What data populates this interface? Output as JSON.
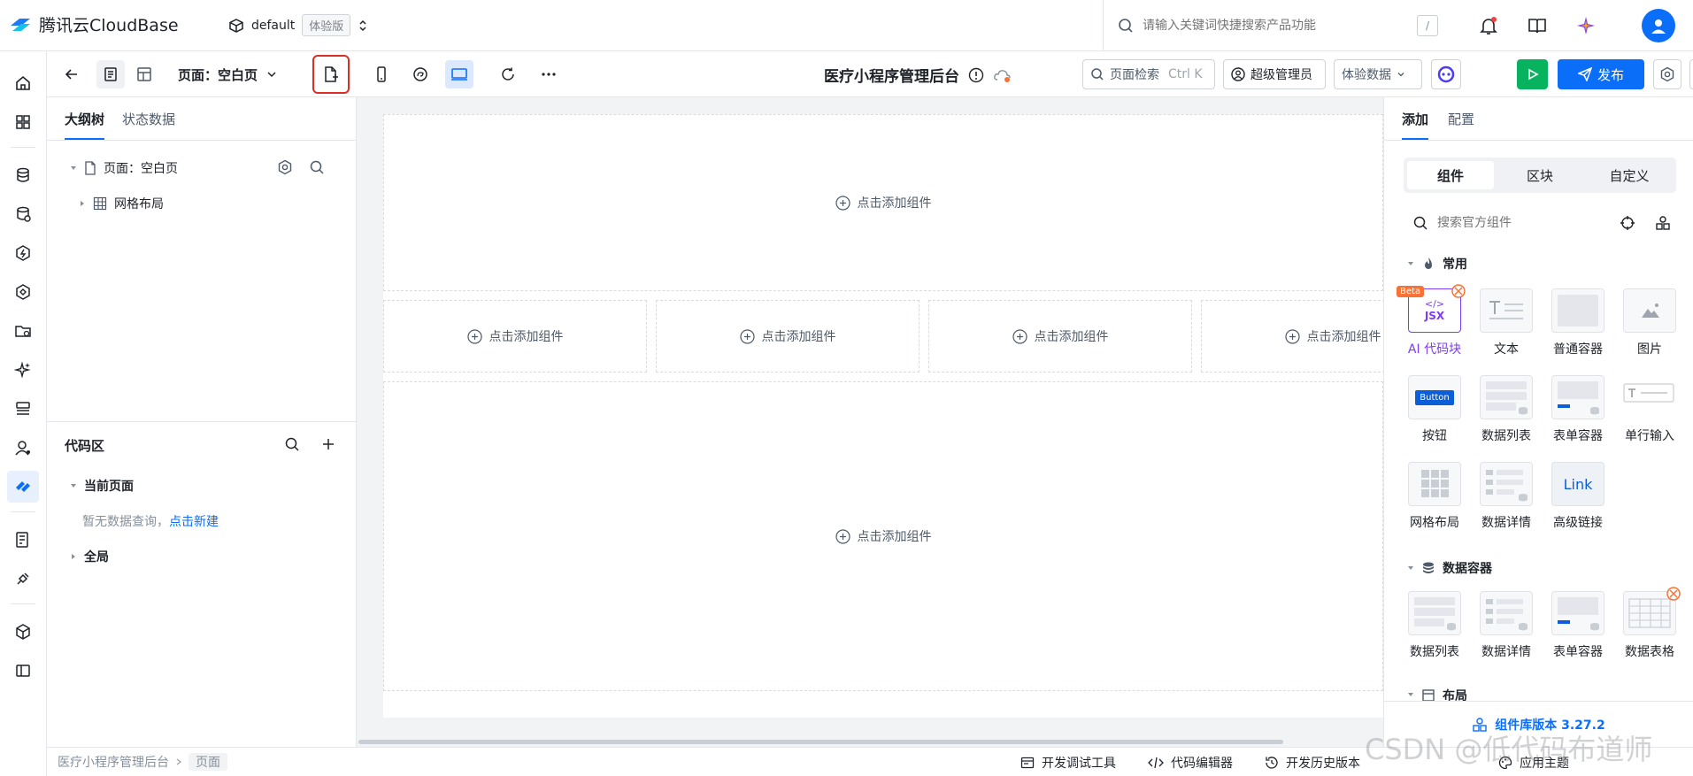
{
  "brand": {
    "name": "腾讯云CloudBase"
  },
  "env": {
    "name": "default",
    "badge": "体验版"
  },
  "global_search": {
    "placeholder": "请输入关键词快捷搜索产品功能",
    "shortcut": "/"
  },
  "toolbar": {
    "page_label": "页面：空白页",
    "app_title": "医疗小程序管理后台",
    "page_search": {
      "label": "页面检索",
      "shortcut": "Ctrl K"
    },
    "role": "超级管理员",
    "data_mode": "体验数据",
    "publish": "发布"
  },
  "left_panel": {
    "tabs": [
      {
        "label": "大纲树"
      },
      {
        "label": "状态数据"
      }
    ],
    "tree": [
      {
        "label": "页面：空白页"
      },
      {
        "label": "网格布局"
      }
    ],
    "code_area": {
      "title": "代码区",
      "current_page": "当前页面",
      "empty_text": "暂无数据查询，",
      "create_link": "点击新建",
      "global": "全局"
    }
  },
  "canvas": {
    "slot_label": "点击添加组件"
  },
  "right_panel": {
    "tabs": [
      {
        "label": "添加"
      },
      {
        "label": "配置"
      }
    ],
    "segments": [
      {
        "label": "组件"
      },
      {
        "label": "区块"
      },
      {
        "label": "自定义"
      }
    ],
    "search_placeholder": "搜索官方组件",
    "groups": [
      {
        "title": "常用",
        "items": [
          {
            "label": "AI 代码块",
            "badge": "Beta",
            "thumb_text": "JSX"
          },
          {
            "label": "文本"
          },
          {
            "label": "普通容器"
          },
          {
            "label": "图片"
          },
          {
            "label": "按钮",
            "thumb_text": "Button"
          },
          {
            "label": "数据列表"
          },
          {
            "label": "表单容器"
          },
          {
            "label": "单行输入"
          },
          {
            "label": "网格布局"
          },
          {
            "label": "数据详情"
          },
          {
            "label": "高级链接",
            "thumb_text": "Link"
          }
        ]
      },
      {
        "title": "数据容器",
        "items": [
          {
            "label": "数据列表"
          },
          {
            "label": "数据详情"
          },
          {
            "label": "表单容器"
          },
          {
            "label": "数据表格"
          }
        ]
      },
      {
        "title": "布局"
      }
    ],
    "lib_version": "组件库版本 3.27.2"
  },
  "bottom_bar": {
    "crumbs": [
      "医疗小程序管理后台",
      "页面"
    ],
    "dev_tools": "开发调试工具",
    "code_editor": "代码编辑器",
    "history": "开发历史版本",
    "theme": "应用主题"
  },
  "watermark": "CSDN @低代码布道师",
  "colors": {
    "accent": "#0b6ef9",
    "run": "#07b35e",
    "highlight_border": "#d93026",
    "beta": "#f77234"
  }
}
